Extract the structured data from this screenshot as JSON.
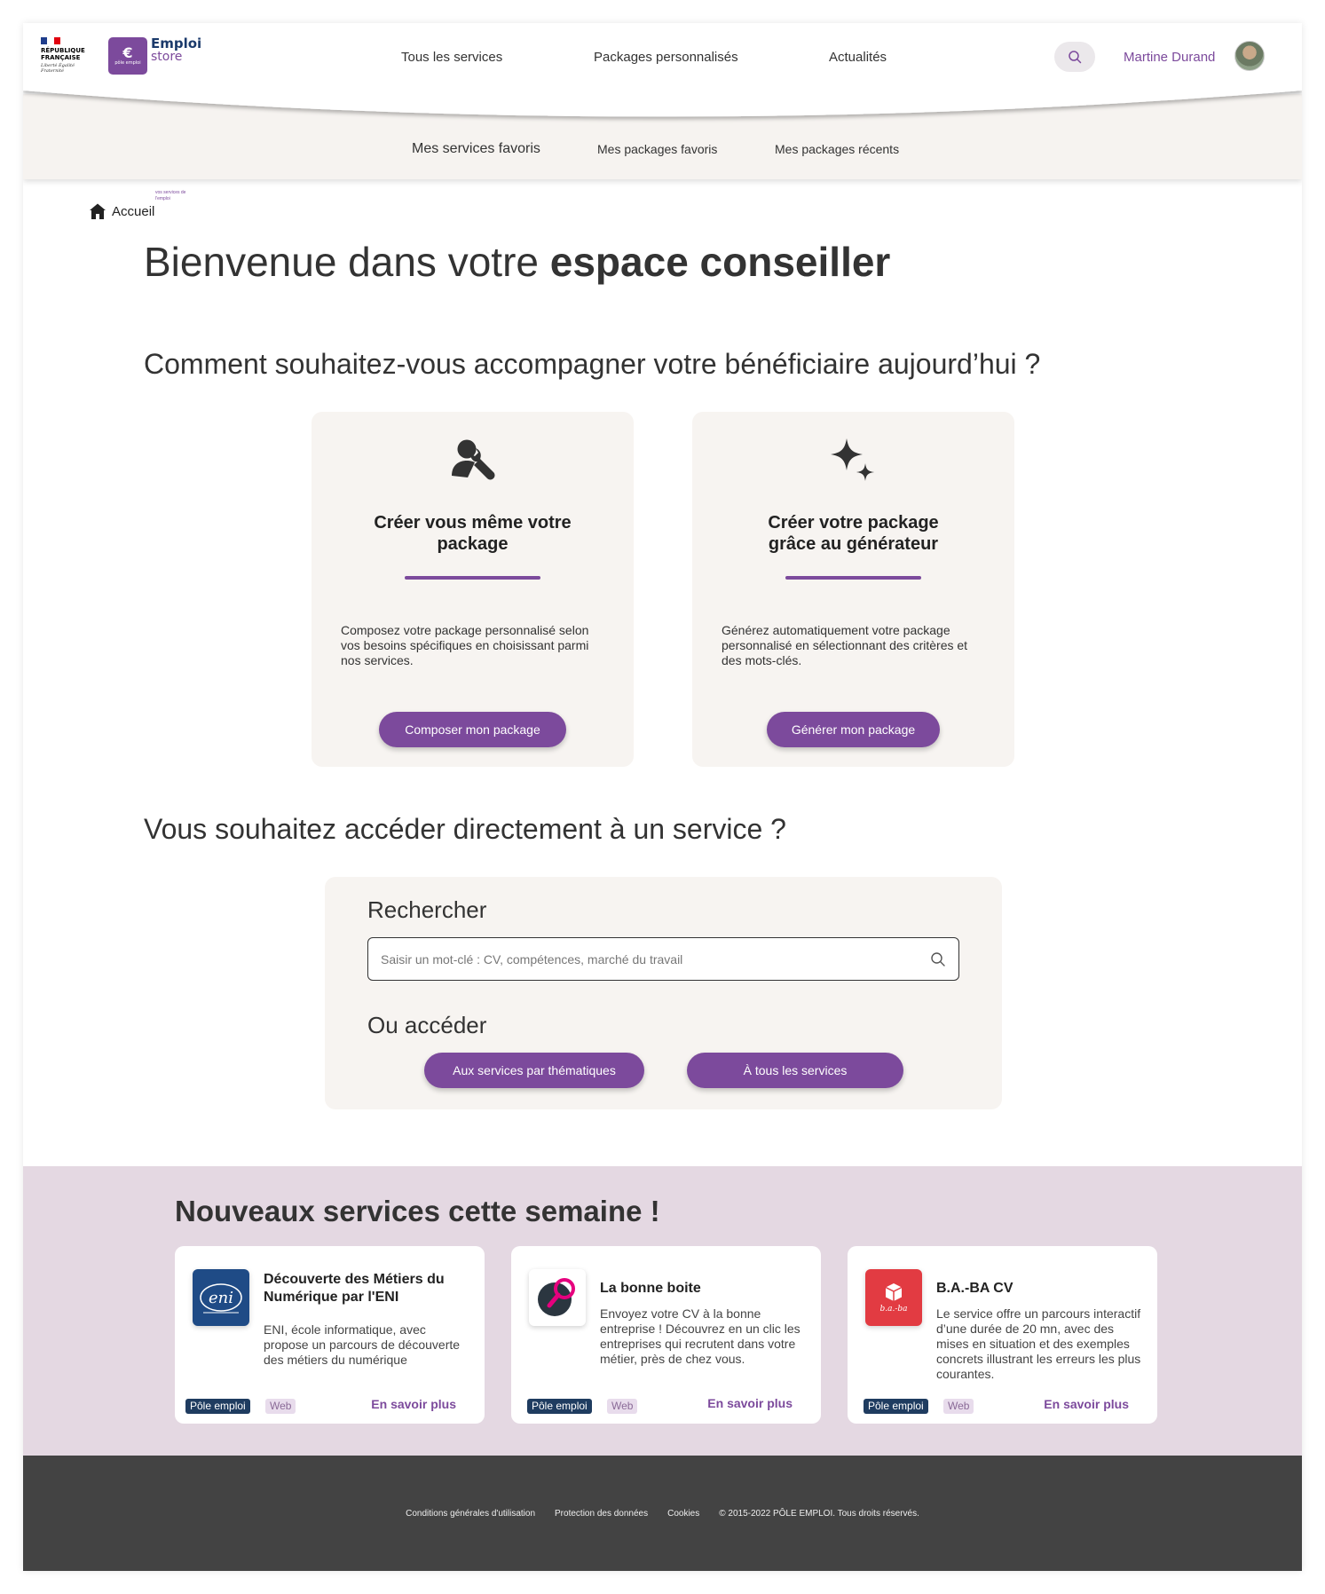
{
  "brand": {
    "republic_line1": "RÉPUBLIQUE",
    "republic_line2": "FRANÇAISE",
    "motto": "Liberté Égalité Fraternité",
    "emploi": "Emploi",
    "store": "store",
    "pole_emploi": "pôle emploi",
    "tagline": "vos services de l'emploi"
  },
  "topnav": {
    "items": [
      "Tous les services",
      "Packages personnalisés",
      "Actualités"
    ],
    "user_name": "Martine Durand"
  },
  "subnav": {
    "items": [
      "Mes services favoris",
      "Mes packages favoris",
      "Mes packages récents"
    ]
  },
  "breadcrumb": {
    "home": "Accueil"
  },
  "welcome": {
    "prefix": "Bienvenue dans votre ",
    "bold": "espace conseiller"
  },
  "question1": "Comment souhaitez-vous accompagner votre bénéficiaire aujourd’hui ?",
  "cards": [
    {
      "icon": "user-wrench-icon",
      "title": "Créer vous même votre package",
      "desc": "Composez votre package personnalisé selon vos besoins spécifiques en choisissant parmi nos services.",
      "button": "Composer mon package"
    },
    {
      "icon": "sparkles-icon",
      "title": "Créer votre package grâce au générateur",
      "desc": "Générez automatiquement votre package personnalisé en sélectionnant des critères et des mots-clés.",
      "button": "Générer mon package"
    }
  ],
  "question2": "Vous souhaitez accéder directement à un service ?",
  "search": {
    "title": "Rechercher",
    "placeholder": "Saisir un mot-clé : CV, compétences, marché du travail",
    "value": "",
    "or_access": "Ou accéder",
    "btn_themes": "Aux services par thématiques",
    "btn_all": "À tous les services"
  },
  "new_services": {
    "title": "Nouveaux services cette semaine !",
    "items": [
      {
        "title": "Découverte des Métiers du Numérique par l'ENI",
        "desc": "ENI, école informatique, avec propose un parcours de découverte des métiers du numérique",
        "logo_text": "eni",
        "tags": [
          "Pôle emploi",
          "Web"
        ],
        "more": "En savoir plus"
      },
      {
        "title": "La bonne boite",
        "desc": "Envoyez votre CV à la bonne entreprise ! Découvrez en un clic les entreprises qui recrutent dans votre métier, près de chez vous.",
        "logo_text": "",
        "tags": [
          "Pôle emploi",
          "Web"
        ],
        "more": "En savoir plus"
      },
      {
        "title": "B.A.-BA CV",
        "desc": "Le service offre un parcours interactif d’une durée de 20 mn, avec des mises en situation et des exemples concrets illustrant les erreurs les plus courantes.",
        "logo_text": "b.a.-ba",
        "tags": [
          "Pôle emploi",
          "Web"
        ],
        "more": "En savoir plus"
      }
    ]
  },
  "footer": {
    "links": [
      "Conditions générales d'utilisation",
      "Protection des données",
      "Cookies",
      "© 2015-2022 PÔLE EMPLOI. Tous droits réservés."
    ]
  },
  "colors": {
    "accent": "#7c4a9c",
    "panel": "#f7f4f1",
    "band": "#e4d8e2",
    "footer": "#434343"
  }
}
